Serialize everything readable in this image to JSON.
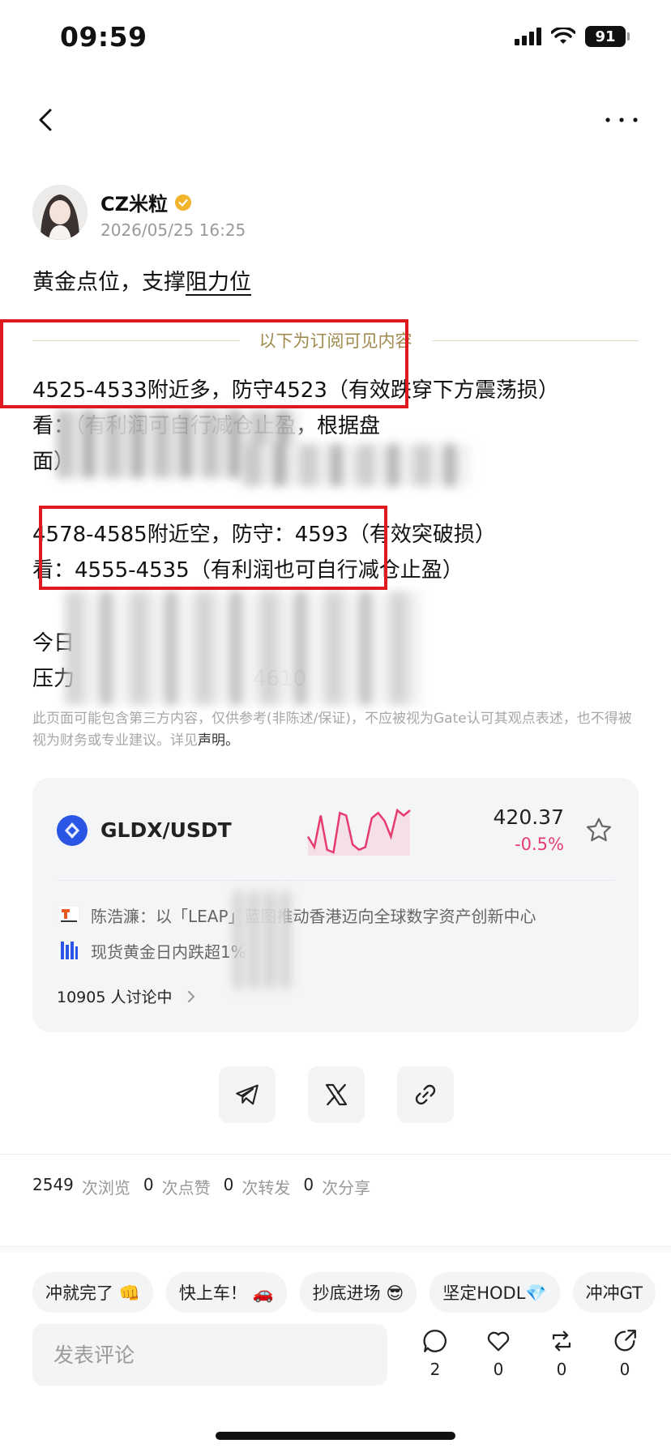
{
  "status_bar": {
    "time": "09:59",
    "battery": "91"
  },
  "author": {
    "name": "CZ米粒",
    "time": "2026/05/25 16:25"
  },
  "post": {
    "title_a": "黄金点位，支撑",
    "title_b": "阻力位",
    "subscribe_divider": "以下为订阅可见内容",
    "line1": "4525-4533附近多，防守4523（有效跌穿下方震荡损）",
    "line2": "看：（有利润可自行减仓止盈，根据盘",
    "line3": "面）",
    "line4": "4578-4585附近空，防守：4593（有效突破损）",
    "line5": "看：4555-4535（有利润也可自行减仓止盈）",
    "line6": "今日",
    "line7": "压力",
    "line7_num": "4610",
    "disclaimer": "此页面可能包含第三方内容，仅供参考(非陈述/保证)，不应被视为Gate认可其观点表述，也不得被视为财务或专业建议。详见",
    "disclaimer_link": "声明。"
  },
  "market": {
    "pair": "GLDX/USDT",
    "price": "420.37",
    "change": "-0.5%",
    "news": [
      {
        "text": "陈浩濂：以「LEAP」蓝图推动香港迈向全球数字资产创新中心",
        "icon": "techub-news-icon"
      },
      {
        "text": "现货黄金日内跌超1%",
        "icon": "bars-news-icon"
      }
    ],
    "discussion": "10905 人讨论中",
    "chart_data": {
      "type": "line",
      "values": [
        30,
        22,
        46,
        20,
        18,
        48,
        46,
        24,
        20,
        22,
        44,
        48,
        42,
        30,
        50,
        46,
        50
      ]
    }
  },
  "stats": {
    "views": "2549",
    "views_label": "次浏览",
    "likes": "0",
    "likes_label": "次点赞",
    "reposts": "0",
    "reposts_label": "次转发",
    "shares": "0",
    "shares_label": "次分享"
  },
  "chips": [
    "冲就完了 👊",
    "快上车！ 🚗",
    "抄底进场 😎",
    "坚定HODL💎",
    "冲冲GT"
  ],
  "comment": {
    "placeholder": "发表评论"
  },
  "actions": {
    "comments": "2",
    "likes": "0",
    "reposts": "0",
    "shares": "0"
  },
  "colors": {
    "accent_red": "#e0191e",
    "down": "#e63b6f",
    "coin": "#2a55e5"
  }
}
